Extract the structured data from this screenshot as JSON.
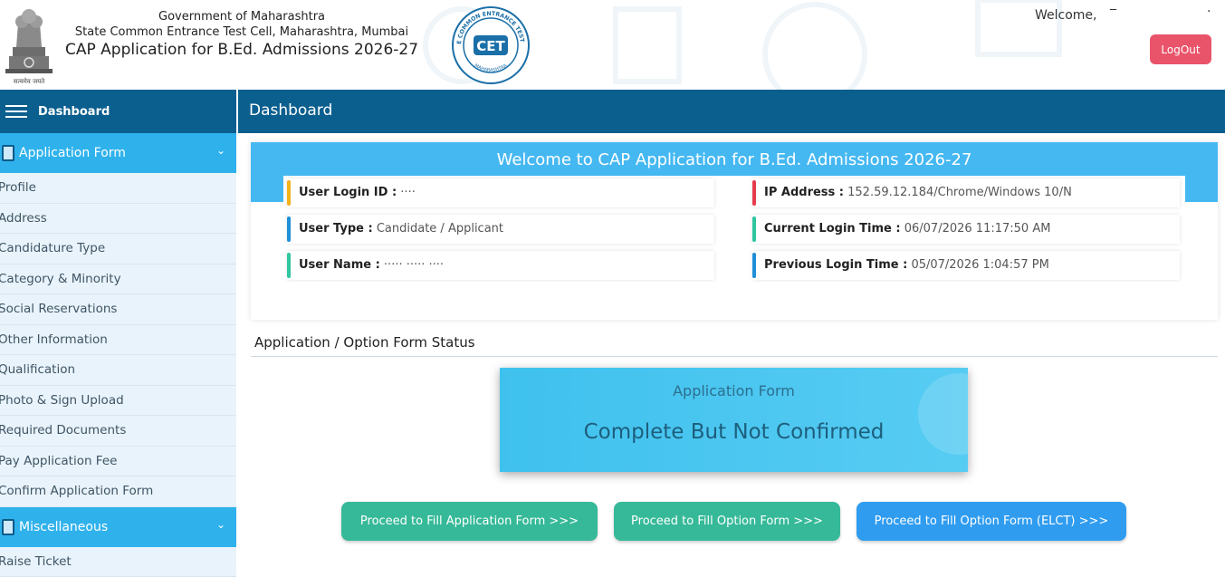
{
  "header": {
    "line1": "Government of Maharashtra",
    "line2": "State Common Entrance Test Cell, Maharashtra, Mumbai",
    "line3": "CAP Application for B.Ed. Admissions 2026-27",
    "emblem_caption": "सत्यमेव जयते",
    "cet_ring_text": "STATE COMMON ENTRANCE TEST CELL",
    "cet_ring_text_bottom": "MAHARASHTRA",
    "cet_letters": "CET",
    "welcome_label": "Welcome,",
    "welcome_user": "‾",
    "welcome_dot": "·",
    "logout_label": "LogOut"
  },
  "sidebar": {
    "title": "Dashboard",
    "sections": [
      {
        "label": "Application Form",
        "items": [
          "Profile",
          "Address",
          "Candidature Type",
          "Category & Minority",
          "Social Reservations",
          "Other Information",
          "Qualification",
          "Photo & Sign Upload",
          "Required Documents",
          "Pay Application Fee",
          "Confirm Application Form"
        ]
      },
      {
        "label": "Miscellaneous",
        "items": [
          "Raise Ticket"
        ]
      }
    ]
  },
  "topbar": {
    "title": "Dashboard"
  },
  "welcome_card": {
    "title": "Welcome to CAP Application for B.Ed. Admissions 2026-27",
    "left": [
      {
        "label": "User Login ID :",
        "value": "      ····",
        "color": "#f2b21b"
      },
      {
        "label": "User Type :",
        "value": " Candidate / Applicant",
        "color": "#1e8fd8"
      },
      {
        "label": "User Name :",
        "value": " ·····   ·····  ····",
        "color": "#2fc6a0"
      }
    ],
    "right": [
      {
        "label": "IP Address :",
        "value": " 152.59.12.184/Chrome/Windows 10/N",
        "color": "#e63b4d"
      },
      {
        "label": "Current Login Time :",
        "value": " 06/07/2026 11:17:50 AM",
        "color": "#2fc6a0"
      },
      {
        "label": "Previous Login Time :",
        "value": " 05/07/2026 1:04:57 PM",
        "color": "#1e8fd8"
      }
    ]
  },
  "status": {
    "heading": "Application / Option Form Status",
    "card_label": "Application Form",
    "card_value": "Complete But Not Confirmed"
  },
  "buttons": {
    "fill_application": "Proceed to Fill Application Form >>>",
    "fill_option": "Proceed to Fill Option Form >>>",
    "fill_option_elct": "Proceed to Fill Option Form (ELCT) >>>"
  }
}
